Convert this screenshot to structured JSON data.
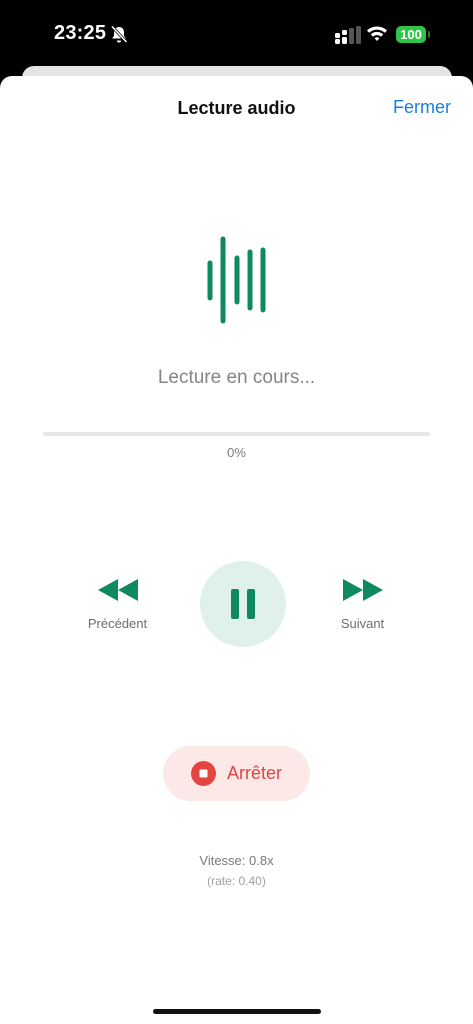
{
  "status_bar": {
    "time": "23:25",
    "battery": "100",
    "icons": [
      "bell-slash-icon",
      "signal-icon",
      "wifi-icon",
      "battery-icon"
    ]
  },
  "header": {
    "title": "Lecture audio",
    "close_label": "Fermer"
  },
  "player": {
    "icon": "audio-wave-icon",
    "status": "Lecture en cours...",
    "progress_percent": 0,
    "progress_label": "0%"
  },
  "controls": {
    "previous_label": "Précédent",
    "next_label": "Suivant",
    "play_state_icon": "pause-icon",
    "stop_label": "Arrêter"
  },
  "speed": {
    "label": "Vitesse: 0.8x",
    "rate": "(rate: 0.40)"
  },
  "colors": {
    "accent_green": "#0f8a5f",
    "link_blue": "#1a7fe0",
    "stop_red": "#e2463f",
    "battery_green": "#30c54a"
  }
}
